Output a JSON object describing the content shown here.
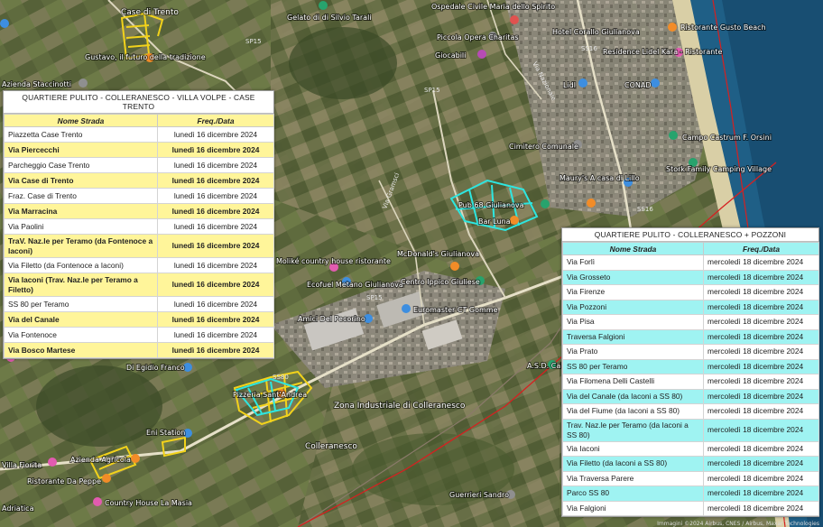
{
  "map": {
    "place_labels": {
      "case_di_trento": "Case di Trento",
      "gustavo": "Gustavo, il futuro della tradizione",
      "azienda_staccinotti": "Azienda Staccinotti",
      "gelato": "Gelato di di Silvio Tarali",
      "piccola_opera": "Piccola Opera Charitas",
      "ospedale": "Ospedale Civile Maria dello Spirito",
      "hotel_corallo": "Hotel Corallo Giulianova",
      "ristorante_gusto": "Ristorante Gusto Beach",
      "residence_lidel": "Residence Lidel Kara - Ristorante",
      "conad": "CONAD",
      "lidl": "Lidl",
      "cimitero": "Cimitero Comunale",
      "campo_castrum": "Campo Castrum F. Orsini",
      "stork_family": "Stork Family Camping Village",
      "maurys": "Maury's A casa di Lillo",
      "pub_bar": "Pub 68 Giulianova",
      "bar_luna": "Bar Luna",
      "mcdonalds": "McDonald's Giulianova",
      "moliké": "Moliké country house ristorante",
      "ecofuel": "Ecofuel Metano Giulianova",
      "centro_ipico": "Centro Ippico Giuliese",
      "euromaster": "Euromaster CT Gomme",
      "amici_del_pecorino": "Amici Del Pecorino",
      "di_egidio": "Di Egidio Franco",
      "zona_industriale": "Zona Industriale di Colleranesco",
      "colleranesco": "Colleranesco",
      "eni_station": "Eni Station",
      "azienda_agricola": "Azienda Agricola",
      "villa_fiorita": "Villa Fiorita",
      "ristorante_da_peppe": "Ristorante Da Peppe",
      "country_house": "Country House La Masia",
      "adriatica": "Adriatica",
      "guerrieri_sandro": "Guerrieri Sandro",
      "asd_calcio": "A.S.D. Calcio",
      "giocabili": "Giocabili",
      "pizzeria_sant_andrea": "Pizzeria Sant'Andrea"
    },
    "road_labels": {
      "sp15": "SP15",
      "sp15b": "SP15",
      "ss16": "SS16",
      "ss16b": "SS16",
      "sp15c": "SP15",
      "ss80": "SS80",
      "via_mazzini": "Via Gramsci",
      "via_nazionale": "Via Nazionale"
    },
    "attribution": "Immagini ©2024 Airbus, CNES / Airbus, Maxar Technologies"
  },
  "left_table": {
    "title": "QUARTIERE PULITO - COLLERANESCO - VILLA VOLPE - CASE TRENTO",
    "headers": [
      "Nome Strada",
      "Freq./Data"
    ],
    "rows": [
      {
        "street": "Piazzetta Case Trento",
        "date": "lunedì 16 dicembre 2024"
      },
      {
        "street": "Via Piercecchi",
        "date": "lunedì 16 dicembre 2024"
      },
      {
        "street": "Parcheggio Case Trento",
        "date": "lunedì 16 dicembre 2024"
      },
      {
        "street": "Via Case di Trento",
        "date": "lunedì 16 dicembre 2024"
      },
      {
        "street": "Fraz. Case di Trento",
        "date": "lunedì 16 dicembre 2024"
      },
      {
        "street": "Via Marracina",
        "date": "lunedì 16 dicembre 2024"
      },
      {
        "street": "Via Paolini",
        "date": "lunedì 16 dicembre 2024"
      },
      {
        "street": "TraV. Naz.le per Teramo (da Fontenoce a Iaconi)",
        "date": "lunedì 16 dicembre 2024"
      },
      {
        "street": "Via Filetto (da Fontenoce a Iaconi)",
        "date": "lunedì 16 dicembre 2024"
      },
      {
        "street": "Via Iaconi (Trav. Naz.le per Teramo a Filetto)",
        "date": "lunedì 16 dicembre 2024"
      },
      {
        "street": "SS 80 per Teramo",
        "date": "lunedì 16 dicembre 2024"
      },
      {
        "street": "Via del Canale",
        "date": "lunedì 16 dicembre 2024"
      },
      {
        "street": "Via Fontenoce",
        "date": "lunedì 16 dicembre 2024"
      },
      {
        "street": "Via Bosco Martese",
        "date": "lunedì 16 dicembre 2024"
      }
    ]
  },
  "right_table": {
    "title": "QUARTIERE PULITO - COLLERANESCO + POZZONI",
    "headers": [
      "Nome Strada",
      "Freq./Data"
    ],
    "rows": [
      {
        "street": "Via Forlì",
        "date": "mercoledì 18 dicembre 2024"
      },
      {
        "street": "Via Grosseto",
        "date": "mercoledì 18 dicembre 2024"
      },
      {
        "street": "Via Firenze",
        "date": "mercoledì 18 dicembre 2024"
      },
      {
        "street": "Via Pozzoni",
        "date": "mercoledì 18 dicembre 2024"
      },
      {
        "street": "Via Pisa",
        "date": "mercoledì 18 dicembre 2024"
      },
      {
        "street": "Traversa Falgioni",
        "date": "mercoledì 18 dicembre 2024"
      },
      {
        "street": "Via Prato",
        "date": "mercoledì 18 dicembre 2024"
      },
      {
        "street": "SS 80 per Teramo",
        "date": "mercoledì 18 dicembre 2024"
      },
      {
        "street": "Via Filomena Delli Castelli",
        "date": "mercoledì 18 dicembre 2024"
      },
      {
        "street": "Via del Canale (da Iaconi a SS 80)",
        "date": "mercoledì 18 dicembre 2024"
      },
      {
        "street": "Via del Fiume (da Iaconi a SS 80)",
        "date": "mercoledì 18 dicembre 2024"
      },
      {
        "street": "Trav. Naz.le per Teramo (da Iaconi a SS 80)",
        "date": "mercoledì 18 dicembre 2024"
      },
      {
        "street": "Via Iaconi",
        "date": "mercoledì 18 dicembre 2024"
      },
      {
        "street": "Via Filetto (da Iaconi a SS 80)",
        "date": "mercoledì 18 dicembre 2024"
      },
      {
        "street": "Via Traversa Parere",
        "date": "mercoledì 18 dicembre 2024"
      },
      {
        "street": "Parco SS 80",
        "date": "mercoledì 18 dicembre 2024"
      },
      {
        "street": "Via Falgioni",
        "date": "mercoledì 18 dicembre 2024"
      }
    ]
  },
  "colors": {
    "left_highlight": "#fff59a",
    "right_highlight": "#9ff3f2",
    "yellow_route": "#f2d21b",
    "cyan_route": "#2ee6e0",
    "boundary": "#d62020",
    "road": "#e6e0c8",
    "sea": "#1f5f86",
    "beach": "#d9cfa6"
  }
}
